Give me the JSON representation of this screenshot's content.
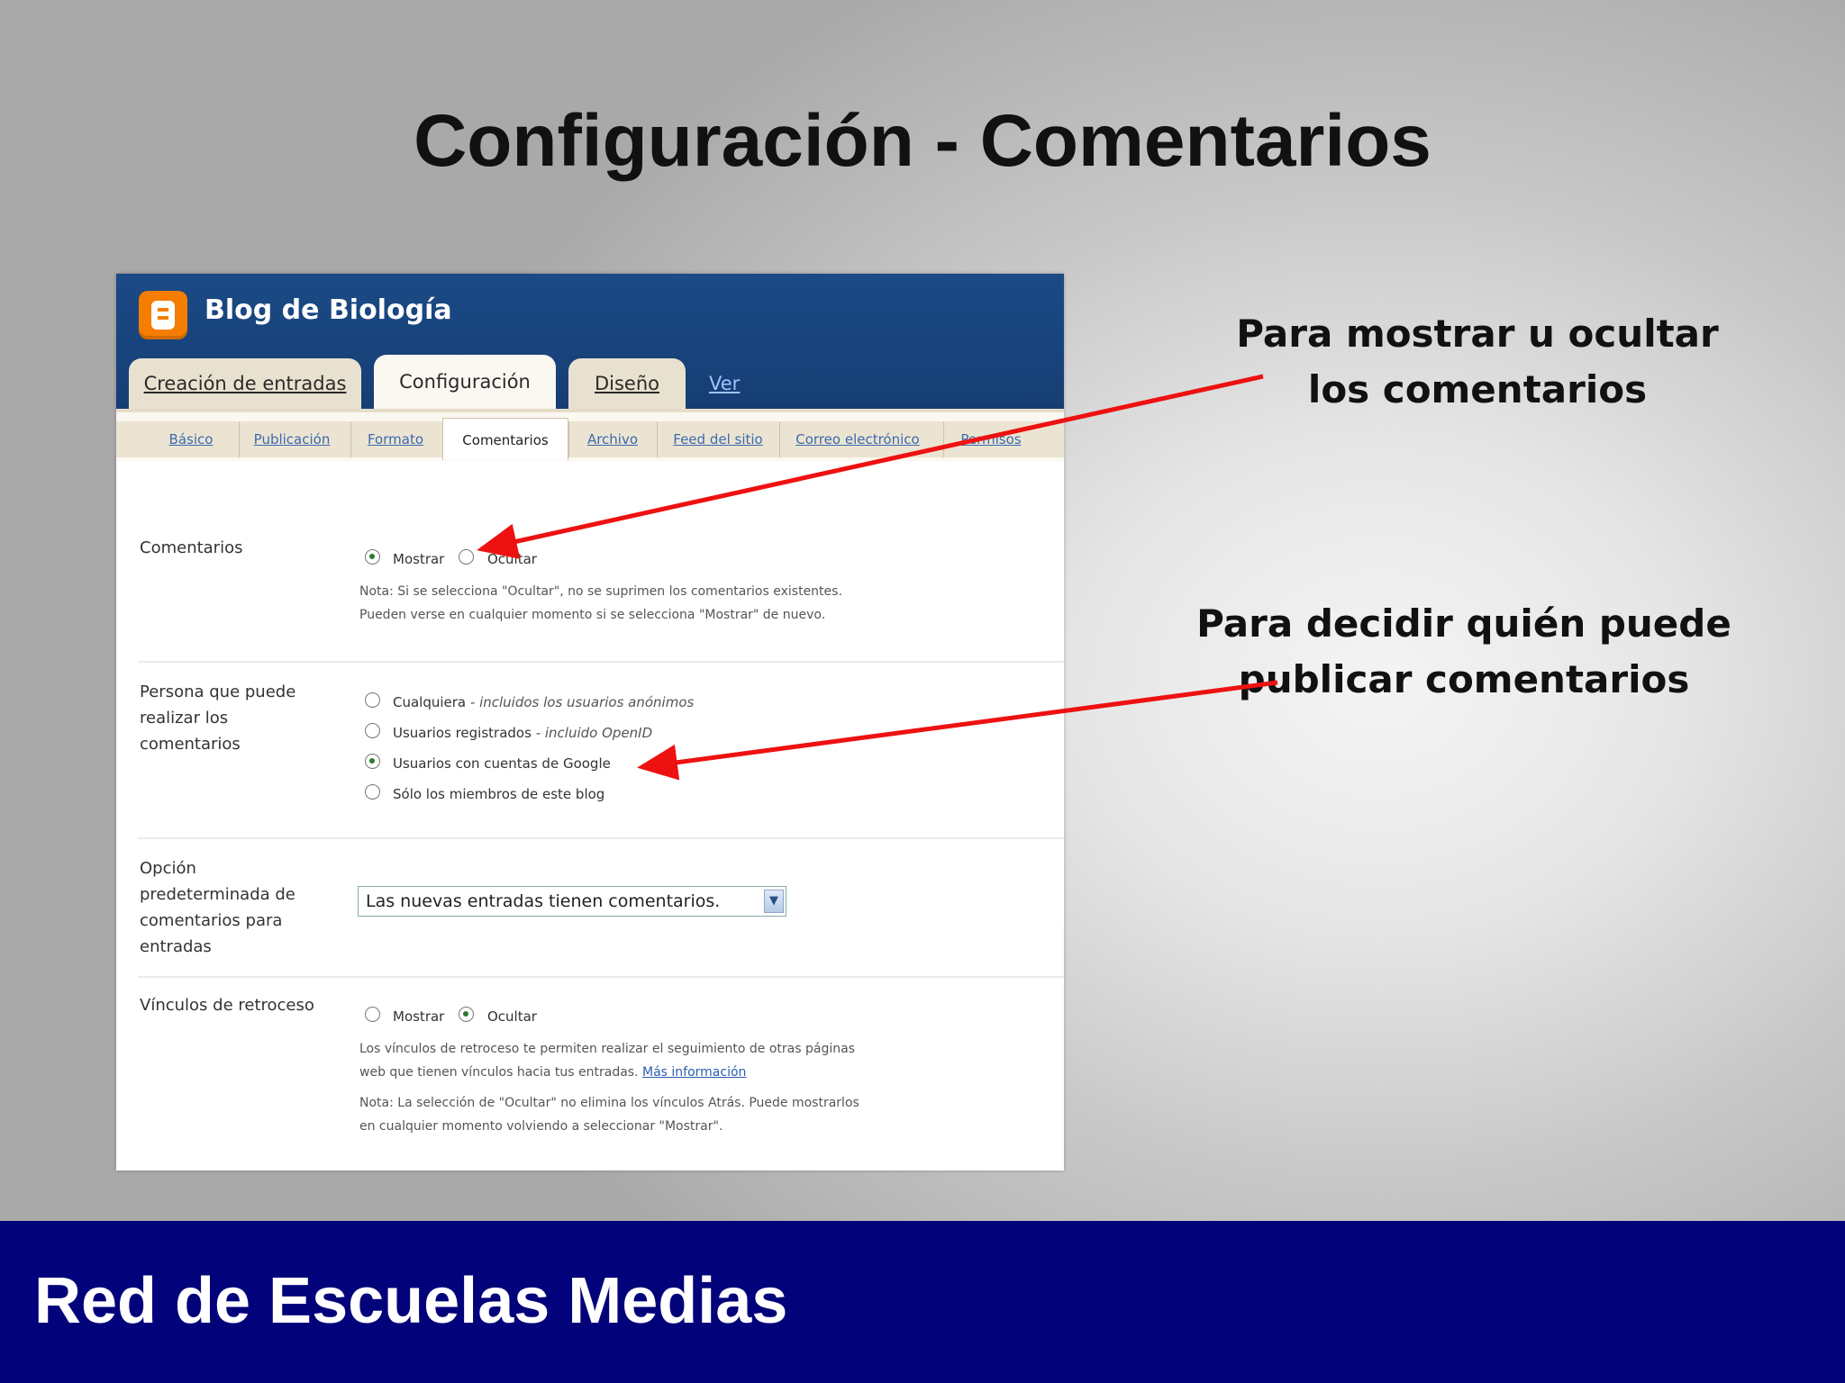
{
  "slide": {
    "title": "Configuración - Comentarios",
    "footer": "Red de Escuelas Medias",
    "note_show_hide": "Para mostrar u ocultar\nlos comentarios",
    "note_who_can": "Para decidir quién puede\npublicar comentarios",
    "arrow_color": "#ee1111",
    "footer_color": "#02037a"
  },
  "blog": {
    "name": "Blog de Biología",
    "brand_color": "#f57d00",
    "header_color": "#1b4a86"
  },
  "main_tabs": {
    "posting": "Creación de entradas",
    "settings": "Configuración",
    "layout": "Diseño",
    "view_blog": "Ver blog"
  },
  "sub_tabs": {
    "basic": "Básico",
    "publishing": "Publicación",
    "formatting": "Formato",
    "comments": "Comentarios",
    "archiving": "Archivo",
    "site_feed": "Feed del sitio",
    "email": "Correo electrónico",
    "permissions": "Permisos"
  },
  "comments": {
    "label": "Comentarios",
    "show": "Mostrar",
    "hide": "Ocultar",
    "selected": "Mostrar",
    "note_line1": "Nota: Si se selecciona \"Ocultar\", no se suprimen los comentarios existentes.",
    "note_line2": "Pueden verse en cualquier momento si se selecciona \"Mostrar\" de nuevo."
  },
  "who_can_comment": {
    "label": "Persona que puede realizar los comentarios",
    "options": [
      {
        "text": "Cualquiera",
        "detail": " - incluidos los usuarios anónimos"
      },
      {
        "text": "Usuarios registrados",
        "detail": " - incluido OpenID"
      },
      {
        "text": "Usuarios con cuentas de Google",
        "detail": ""
      },
      {
        "text": "Sólo los miembros de este blog",
        "detail": ""
      }
    ],
    "selected": "Usuarios con cuentas de Google"
  },
  "default_option": {
    "label": "Opción predeterminada de comentarios para entradas",
    "value": "Las nuevas entradas tienen comentarios."
  },
  "backlinks": {
    "label": "Vínculos de retroceso",
    "show": "Mostrar",
    "hide": "Ocultar",
    "selected": "Ocultar",
    "desc_line1": "Los vínculos de retroceso te permiten realizar el seguimiento de otras páginas",
    "desc_line2": "web que tienen vínculos hacia tus entradas.",
    "more_info": "Más información",
    "note_line1": "Nota: La selección de \"Ocultar\" no elimina los vínculos Atrás. Puede mostrarlos",
    "note_line2": "en cualquier momento volviendo a seleccionar \"Mostrar\"."
  }
}
